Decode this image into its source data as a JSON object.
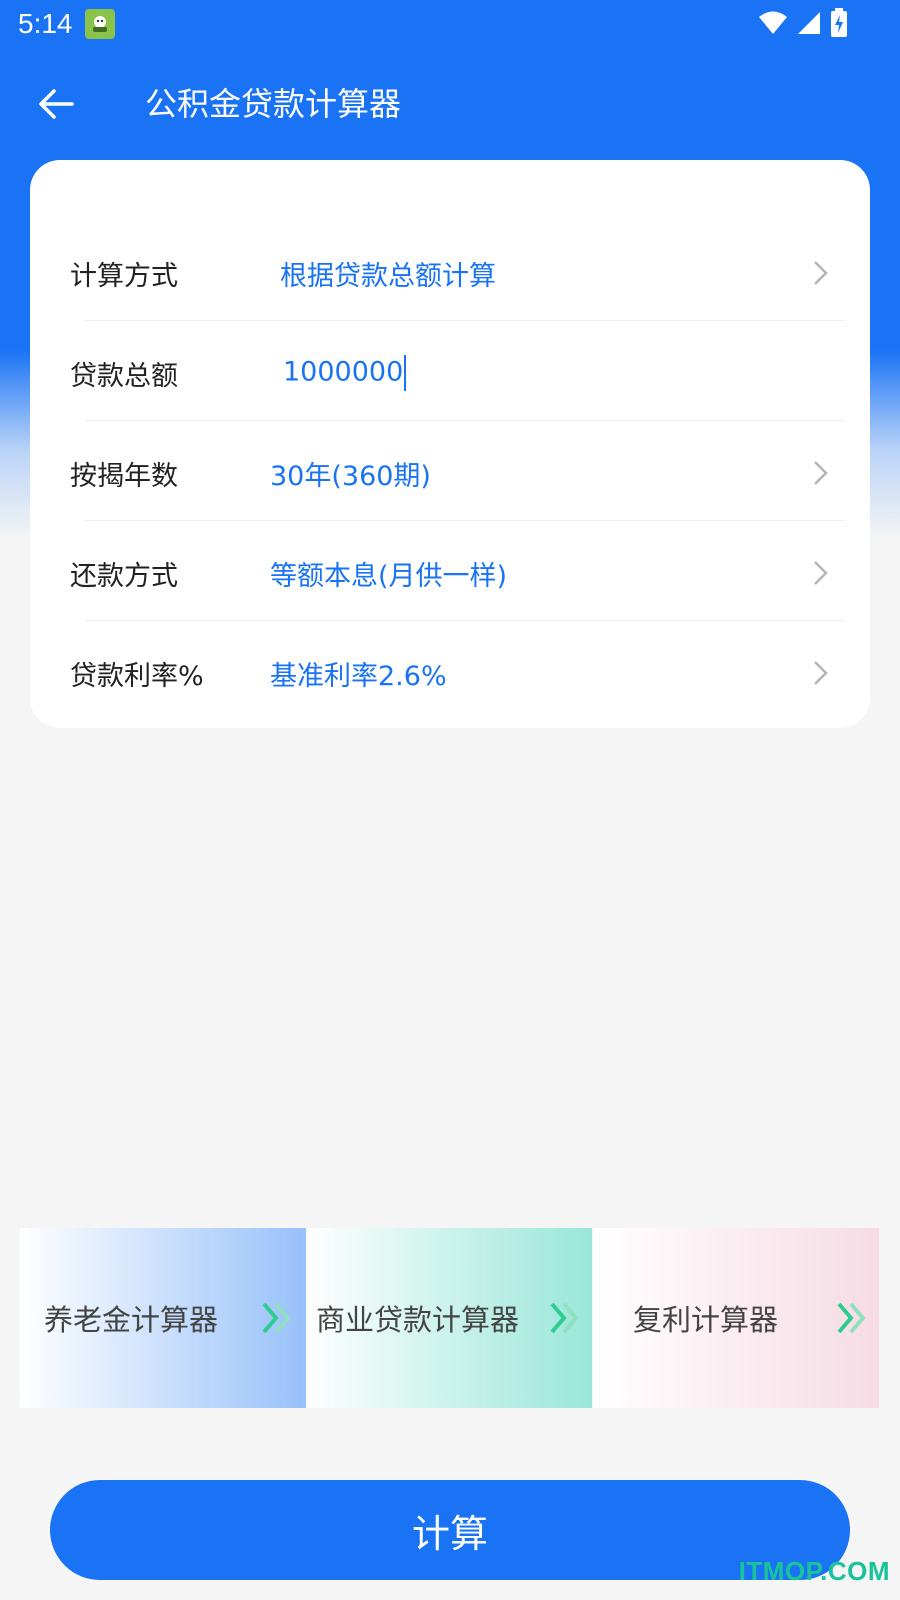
{
  "status_bar": {
    "time": "5:14"
  },
  "app_bar": {
    "title": "公积金贷款计算器"
  },
  "form": {
    "rows": [
      {
        "label": "计算方式",
        "value": "根据贷款总额计算"
      },
      {
        "label": "贷款总额",
        "value": "1000000"
      },
      {
        "label": "按揭年数",
        "value": "30年(360期)"
      },
      {
        "label": "还款方式",
        "value": "等额本息(月供一样)"
      },
      {
        "label": "贷款利率%",
        "value": "基准利率2.6%"
      }
    ]
  },
  "shortcuts": [
    {
      "label": "养老金计算器"
    },
    {
      "label": "商业贷款计算器"
    },
    {
      "label": "复利计算器"
    }
  ],
  "calculate_button": {
    "label": "计算"
  },
  "watermark": "ITMOP.COM",
  "colors": {
    "primary": "#1a73f5",
    "arrow_green": "#2ecc8f"
  }
}
